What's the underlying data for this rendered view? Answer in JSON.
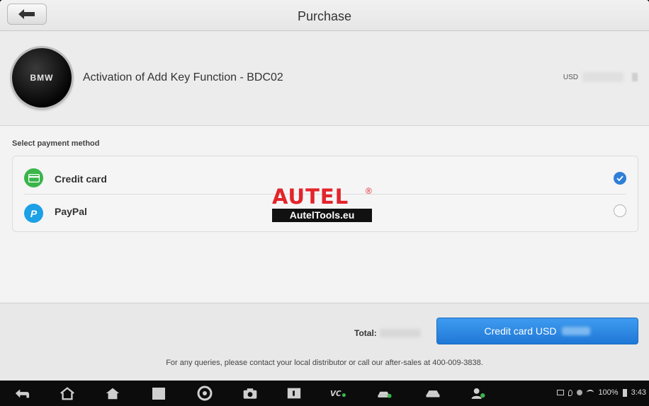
{
  "header": {
    "title": "Purchase"
  },
  "product": {
    "logo_text": "BMW",
    "name": "Activation of Add Key Function - BDC02",
    "currency": "USD"
  },
  "payment": {
    "label": "Select payment method",
    "methods": [
      {
        "name": "Credit card",
        "selected": true
      },
      {
        "name": "PayPal",
        "selected": false
      }
    ]
  },
  "watermark": {
    "brand": "AUTEL",
    "reg": "®",
    "site": "AutelTools.eu"
  },
  "footer": {
    "total_label": "Total:",
    "pay_button_label": "Credit card USD",
    "contact_text": "For any queries, please contact your local distributor or call our after-sales at 400-009-3838."
  },
  "statusbar": {
    "battery": "100%",
    "time": "3:43"
  },
  "colors": {
    "accent": "#2f7fd8",
    "credit_icon": "#3ab54a",
    "paypal_icon": "#1ca0e6",
    "watermark_red": "#e3242b"
  }
}
